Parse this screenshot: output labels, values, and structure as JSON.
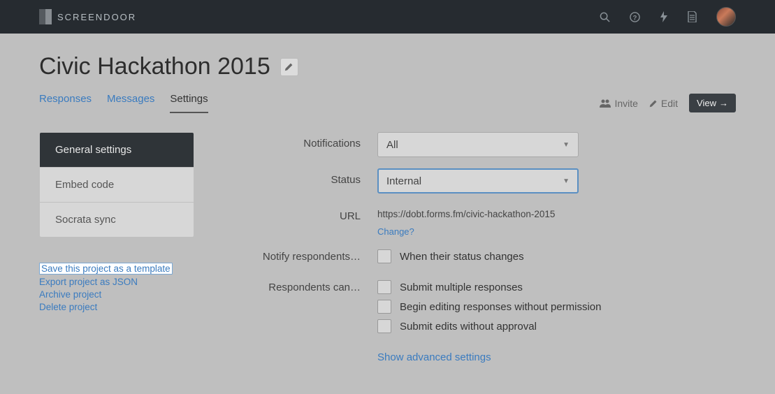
{
  "brand": {
    "name": "SCREENDOOR"
  },
  "header": {
    "title": "Civic Hackathon 2015",
    "tabs": {
      "responses": "Responses",
      "messages": "Messages",
      "settings": "Settings"
    },
    "actions": {
      "invite": "Invite",
      "edit": "Edit",
      "view": "View"
    }
  },
  "sidebar": {
    "nav": {
      "general": "General settings",
      "embed": "Embed code",
      "socrata": "Socrata sync"
    },
    "links": {
      "save_template": "Save this project as a template",
      "export_json": "Export project as JSON",
      "archive": "Archive project",
      "delete": "Delete project"
    }
  },
  "form": {
    "labels": {
      "notifications": "Notifications",
      "status": "Status",
      "url": "URL",
      "notify": "Notify respondents…",
      "respondents_can": "Respondents can…"
    },
    "values": {
      "notifications": "All",
      "status": "Internal",
      "url": "https://dobt.forms.fm/civic-hackathon-2015"
    },
    "change_link": "Change?",
    "checkboxes": {
      "status_changes": "When their status changes",
      "multiple": "Submit multiple responses",
      "edit_no_permission": "Begin editing responses without permission",
      "edit_no_approval": "Submit edits without approval"
    },
    "advanced": "Show advanced settings"
  }
}
